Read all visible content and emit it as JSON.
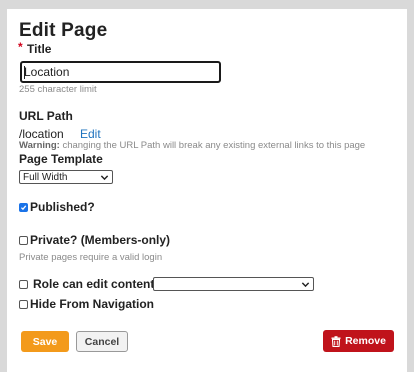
{
  "page": {
    "title": "Edit Page",
    "required_marker": "*",
    "title_label": "Title",
    "title_value": "Location",
    "title_hint": "255 character limit",
    "url_label": "URL Path",
    "url_value": "/location",
    "url_edit": "Edit",
    "warning_bold": "Warning:",
    "warning_text": " changing the URL Path will break any existing external links to this page",
    "template_label": "Page Template",
    "template_value": "Full Width",
    "published_label": "Published?",
    "published_checked": true,
    "private_label": "Private? (Members-only)",
    "private_hint": "Private pages require a valid login",
    "role_label": "Role can edit content",
    "role_value": "",
    "hide_nav_label": "Hide From Navigation"
  },
  "buttons": {
    "save": "Save",
    "cancel": "Cancel",
    "remove": "Remove"
  },
  "colors": {
    "save_bg": "#f39a1b",
    "remove_bg": "#c0131b",
    "link": "#1e73be",
    "checkbox_checked": "#1a73e8"
  },
  "icons": {
    "remove": "trash-icon",
    "select": "chevron-down-icon",
    "checkbox": "checkmark-icon"
  }
}
